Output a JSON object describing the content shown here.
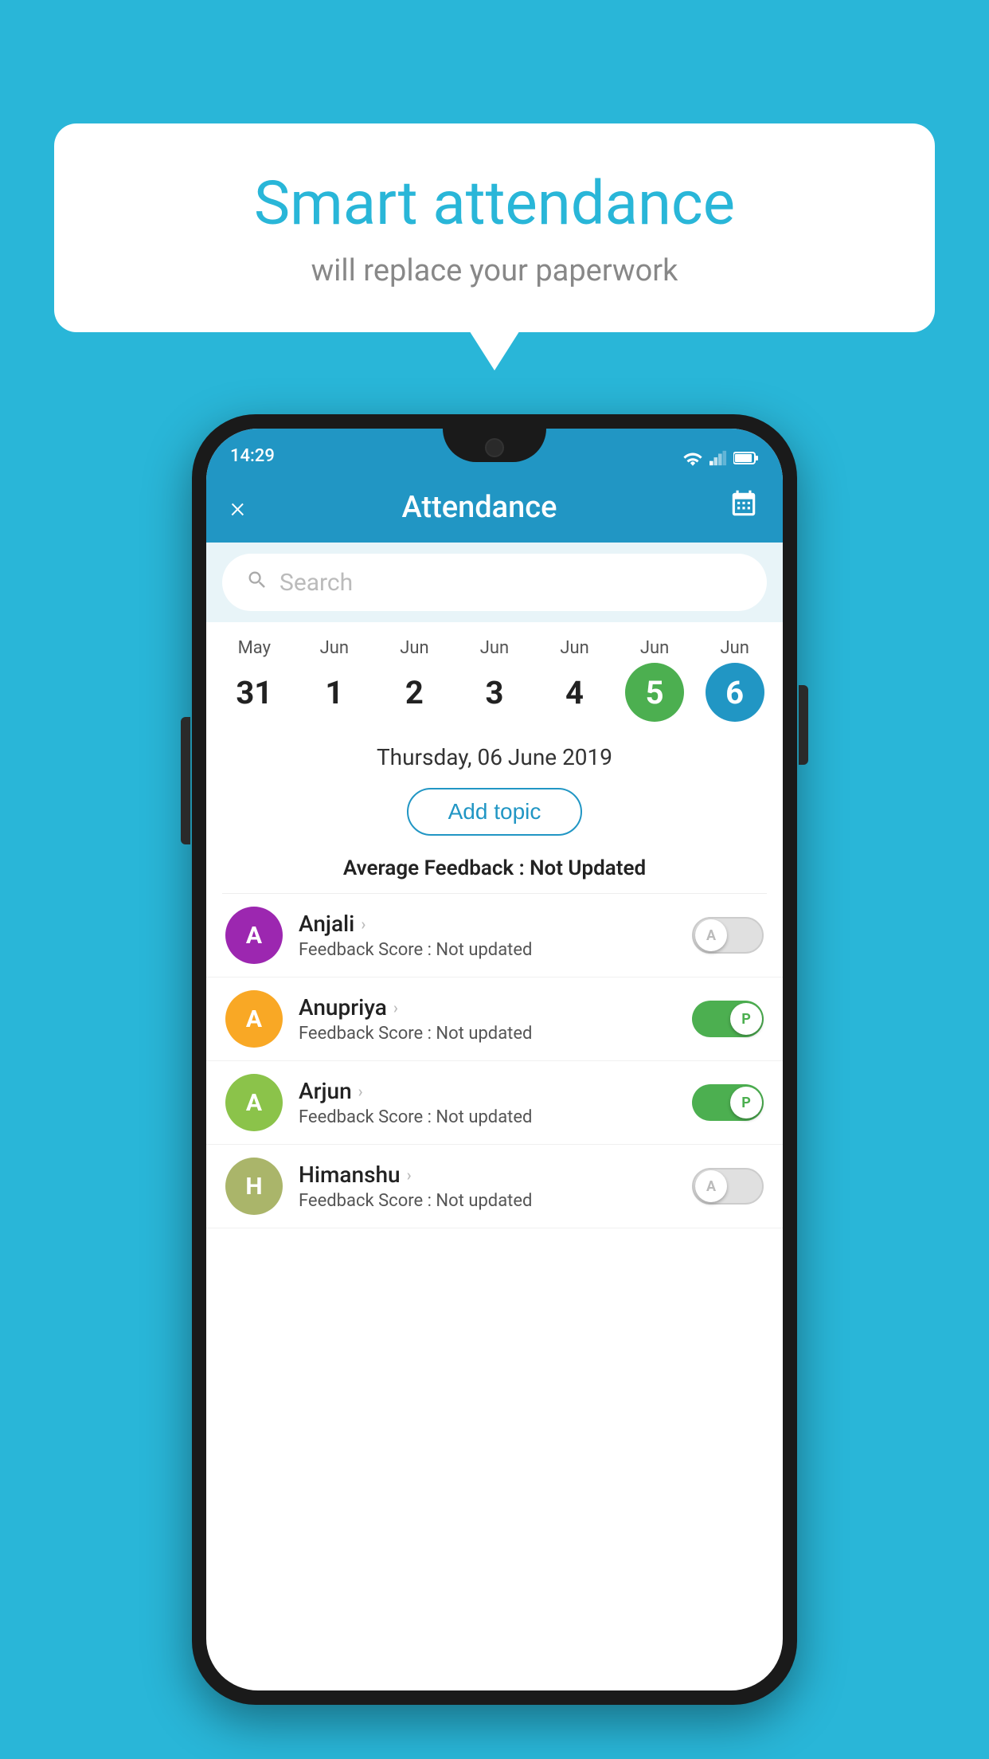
{
  "background_color": "#29b6d8",
  "bubble": {
    "title": "Smart attendance",
    "subtitle": "will replace your paperwork"
  },
  "status_bar": {
    "time": "14:29"
  },
  "header": {
    "title": "Attendance",
    "close_label": "×"
  },
  "search": {
    "placeholder": "Search"
  },
  "calendar": {
    "days": [
      {
        "month": "May",
        "date": "31",
        "state": "normal"
      },
      {
        "month": "Jun",
        "date": "1",
        "state": "normal"
      },
      {
        "month": "Jun",
        "date": "2",
        "state": "normal"
      },
      {
        "month": "Jun",
        "date": "3",
        "state": "normal"
      },
      {
        "month": "Jun",
        "date": "4",
        "state": "normal"
      },
      {
        "month": "Jun",
        "date": "5",
        "state": "today"
      },
      {
        "month": "Jun",
        "date": "6",
        "state": "selected"
      }
    ],
    "selected_date_label": "Thursday, 06 June 2019"
  },
  "add_topic_label": "Add topic",
  "avg_feedback_label": "Average Feedback :",
  "avg_feedback_value": "Not Updated",
  "students": [
    {
      "name": "Anjali",
      "avatar_letter": "A",
      "avatar_color": "#9c27b0",
      "feedback_label": "Feedback Score :",
      "feedback_value": "Not updated",
      "toggle": "off",
      "toggle_label": "A"
    },
    {
      "name": "Anupriya",
      "avatar_letter": "A",
      "avatar_color": "#f9a825",
      "feedback_label": "Feedback Score :",
      "feedback_value": "Not updated",
      "toggle": "on",
      "toggle_label": "P"
    },
    {
      "name": "Arjun",
      "avatar_letter": "A",
      "avatar_color": "#8bc34a",
      "feedback_label": "Feedback Score :",
      "feedback_value": "Not updated",
      "toggle": "on",
      "toggle_label": "P"
    },
    {
      "name": "Himanshu",
      "avatar_letter": "H",
      "avatar_color": "#aab56a",
      "feedback_label": "Feedback Score :",
      "feedback_value": "Not updated",
      "toggle": "off",
      "toggle_label": "A"
    }
  ]
}
